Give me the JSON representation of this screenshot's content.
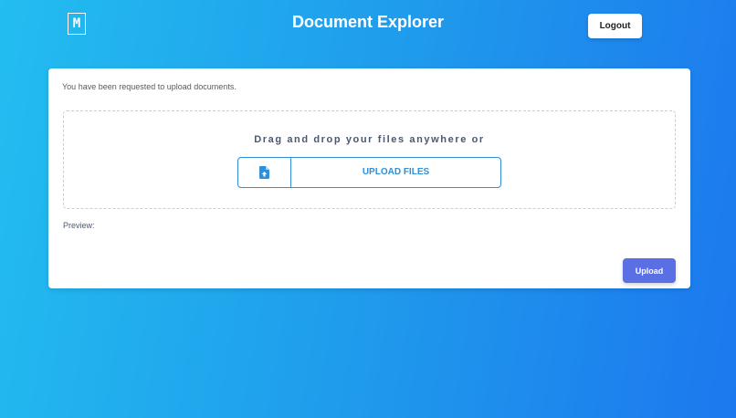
{
  "header": {
    "logo_text": "M",
    "title": "Document Explorer",
    "logout_label": "Logout"
  },
  "card": {
    "request_message": "You have been requested to upload documents.",
    "dropzone": {
      "instruction": "Drag and drop your files anywhere or",
      "upload_files_label": "UPLOAD FILES",
      "icon": "file-upload-icon"
    },
    "preview_label": "Preview:",
    "upload_label": "Upload"
  },
  "colors": {
    "background_start": "#23bdf0",
    "background_end": "#1c78ee",
    "accent_blue": "#2f8fd8",
    "upload_button": "#5a6fe3",
    "text_muted": "#4a5872"
  }
}
